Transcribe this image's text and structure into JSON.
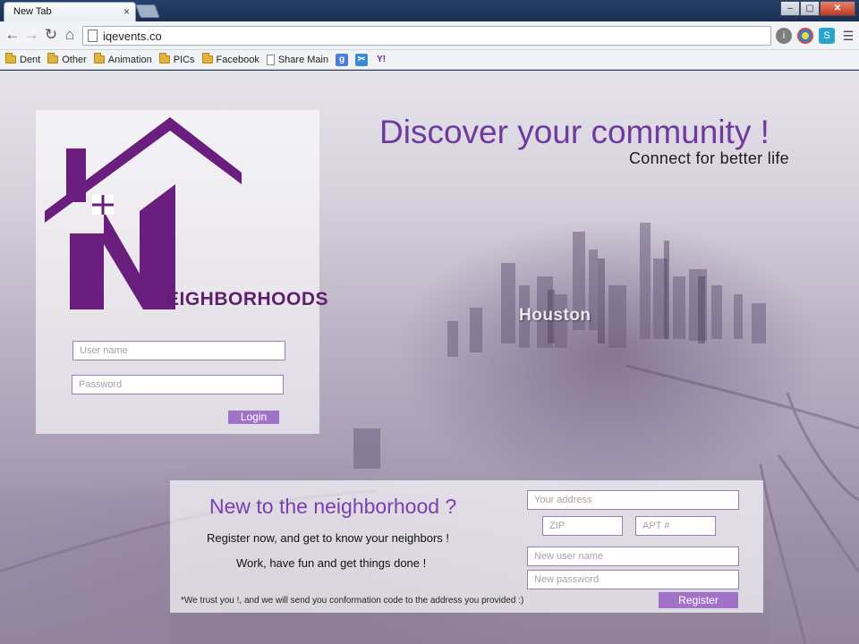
{
  "browser": {
    "tab_title": "New Tab",
    "tab_close": "×",
    "url": "iqevents.co",
    "window_controls": [
      "–",
      "▢",
      "✕"
    ],
    "nav_icons": [
      "back-arrow-icon",
      "forward-arrow-icon",
      "reload-icon",
      "home-icon"
    ],
    "bookmarks": [
      {
        "label": "Dent",
        "icon": "folder-icon"
      },
      {
        "label": "Other",
        "icon": "folder-icon"
      },
      {
        "label": "Animation",
        "icon": "folder-icon"
      },
      {
        "label": "PICs",
        "icon": "folder-icon"
      },
      {
        "label": "Facebook",
        "icon": "folder-icon"
      },
      {
        "label": "Share Main",
        "icon": "page-icon"
      }
    ],
    "bookmark_icons": [
      {
        "glyph": "g",
        "color": "#4a7be0"
      },
      {
        "glyph": "✂",
        "color": "#3b8bd0"
      },
      {
        "glyph": "Y!",
        "color": "#6d1fa3"
      }
    ]
  },
  "colors": {
    "accent_purple": "#6e3a9e",
    "button_purple": "#a173c8",
    "logo_purple": "#6a1f7e"
  },
  "hero": {
    "logo_text": "EIGHBORHOODS",
    "headline": "Discover your community !",
    "tagline": "Connect for better life",
    "map_label": "Houston"
  },
  "login": {
    "username_placeholder": "User name",
    "password_placeholder": "Password",
    "button": "Login"
  },
  "register": {
    "title": "New to the neighborhood ?",
    "line1": "Register now, and get to know your neighbors !",
    "line2": "Work, have fun and get things done !",
    "note": "*We trust you !, and we will send you conformation code to the address you provided :)",
    "address_placeholder": "Your address",
    "zip_placeholder": "ZIP",
    "apt_placeholder": "APT #",
    "new_username_placeholder": "New user name",
    "new_password_placeholder": "New password",
    "button": "Register"
  }
}
